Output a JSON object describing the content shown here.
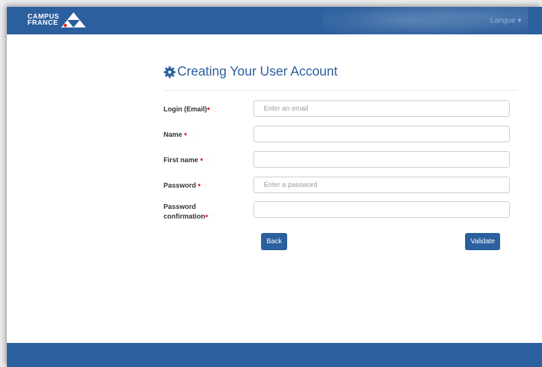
{
  "header": {
    "logo_line1": "CAMPUS",
    "logo_line2": "FRANCE",
    "language_label": "Langue ▾"
  },
  "form": {
    "title": "Creating Your User Account",
    "fields": [
      {
        "label": "Login (Email)",
        "placeholder": "Enter an email",
        "value": ""
      },
      {
        "label": "Name",
        "placeholder": "",
        "value": ""
      },
      {
        "label": "First name",
        "placeholder": "",
        "value": ""
      },
      {
        "label": "Password",
        "placeholder": "Enter a password",
        "value": ""
      },
      {
        "label_line1": "Password",
        "label_line2": "confirmation",
        "placeholder": "",
        "value": ""
      }
    ],
    "required_marker": "•",
    "colon": ":",
    "back_label": "Back",
    "validate_label": "Validate"
  },
  "colors": {
    "brand_blue": "#2b5f9e",
    "required_red": "#e02020"
  }
}
